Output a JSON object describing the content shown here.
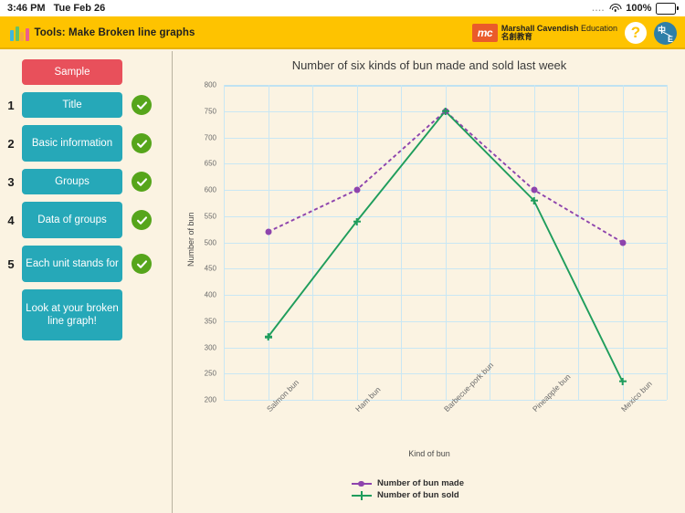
{
  "statusbar": {
    "time": "3:46 PM",
    "date": "Tue Feb 26",
    "dots": "....",
    "wifi_icon": "wifi-icon",
    "battery_percent": "100%",
    "battery_icon": "battery-full-icon"
  },
  "appbar": {
    "logo_icon": "bar-chart-logo-icon",
    "title": "Tools: Make Broken line graphs",
    "publisher": {
      "badge": "mc",
      "line1_bold": "Marshall Cavendish",
      "line1_light": "Education",
      "line2": "名創教育"
    },
    "help_label": "?",
    "help_icon": "help-question-icon",
    "language_cn": "中",
    "language_en": "E",
    "language_icon": "language-toggle-icon"
  },
  "sidebar": {
    "sample_label": "Sample",
    "steps": [
      {
        "num": "1",
        "label": "Title",
        "checked": true
      },
      {
        "num": "2",
        "label": "Basic information",
        "checked": true
      },
      {
        "num": "3",
        "label": "Groups",
        "checked": true
      },
      {
        "num": "4",
        "label": "Data of groups",
        "checked": true
      },
      {
        "num": "5",
        "label": "Each unit stands for",
        "checked": true
      }
    ],
    "final_label": "Look at your broken line graph!",
    "check_icon": "check-circle-icon"
  },
  "colors": {
    "brand_yellow": "#fec300",
    "panel_cream": "#fbf3e2",
    "teal": "#26a8b8",
    "red": "#e8505b",
    "green_check": "#56a51b",
    "grid_blue": "#c9e7f4",
    "series_made": "#8e44ad",
    "series_sold": "#1f9d5c"
  },
  "chart_data": {
    "type": "line",
    "title": "Number of six kinds of bun made and sold last week",
    "xlabel": "Kind of bun",
    "ylabel": "Number of bun",
    "categories": [
      "Salmon bun",
      "Ham bun",
      "Barbecue-pork bun",
      "Pineapple bun",
      "Mexico bun"
    ],
    "series": [
      {
        "name": "Number of bun made",
        "values": [
          520,
          600,
          750,
          600,
          500
        ],
        "color": "#8e44ad",
        "style": "dashed",
        "marker": "circle"
      },
      {
        "name": "Number of bun sold",
        "values": [
          320,
          540,
          750,
          580,
          235
        ],
        "color": "#1f9d5c",
        "style": "solid",
        "marker": "cross"
      }
    ],
    "ylim": [
      200,
      800
    ],
    "ytick_step": 50,
    "yticks": [
      800,
      750,
      700,
      650,
      600,
      550,
      500,
      450,
      400,
      350,
      300,
      250,
      200
    ],
    "grid": true,
    "legend_position": "bottom"
  }
}
